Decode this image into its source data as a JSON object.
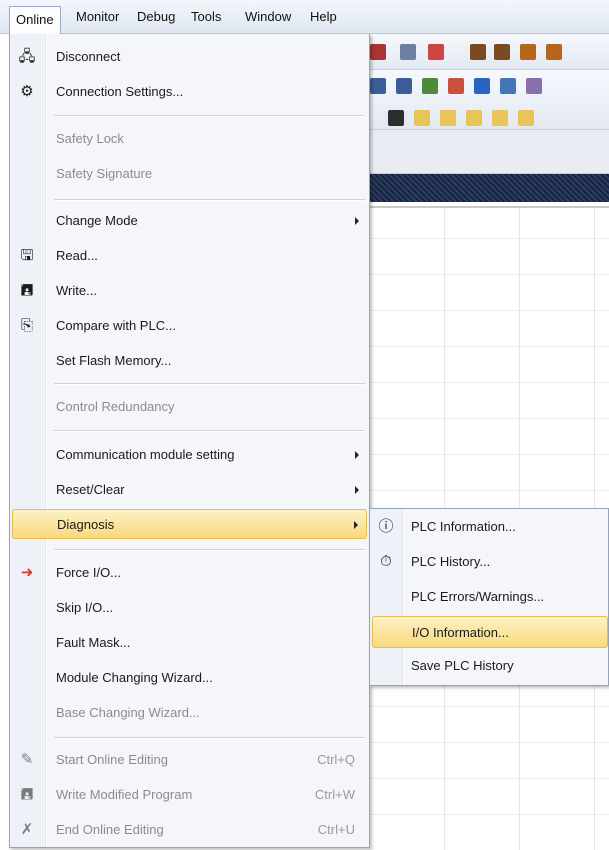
{
  "menubar": {
    "items": [
      {
        "label": "Online"
      },
      {
        "label": "Monitor"
      },
      {
        "label": "Debug"
      },
      {
        "label": "Tools"
      },
      {
        "label": "Window"
      },
      {
        "label": "Help"
      }
    ]
  },
  "online_menu": {
    "items": [
      {
        "label": "Disconnect",
        "icon": "disconnect-icon"
      },
      {
        "label": "Connection Settings...",
        "icon": "connection-settings-icon"
      },
      {
        "label": "Safety Lock"
      },
      {
        "label": "Safety Signature"
      },
      {
        "label": "Change Mode"
      },
      {
        "label": "Read...",
        "icon": "read-icon"
      },
      {
        "label": "Write...",
        "icon": "write-icon"
      },
      {
        "label": "Compare with PLC...",
        "icon": "compare-icon"
      },
      {
        "label": "Set Flash Memory..."
      },
      {
        "label": "Control Redundancy"
      },
      {
        "label": "Communication module setting"
      },
      {
        "label": "Reset/Clear"
      },
      {
        "label": "Diagnosis"
      },
      {
        "label": "Force I/O...",
        "icon": "force-io-icon"
      },
      {
        "label": "Skip I/O..."
      },
      {
        "label": "Fault Mask..."
      },
      {
        "label": "Module Changing Wizard..."
      },
      {
        "label": "Base Changing Wizard..."
      },
      {
        "label": "Start Online Editing",
        "shortcut": "Ctrl+Q",
        "icon": "online-edit-icon"
      },
      {
        "label": "Write Modified Program",
        "shortcut": "Ctrl+W",
        "icon": "write-modified-icon"
      },
      {
        "label": "End Online Editing",
        "shortcut": "Ctrl+U",
        "icon": "end-edit-icon"
      }
    ]
  },
  "diagnosis_submenu": {
    "items": [
      {
        "label": "PLC Information...",
        "icon": "plc-information-icon"
      },
      {
        "label": "PLC History...",
        "icon": "plc-history-icon"
      },
      {
        "label": "PLC Errors/Warnings..."
      },
      {
        "label": "I/O Information..."
      },
      {
        "label": "Save PLC History"
      }
    ]
  },
  "colors": {
    "highlight": "#f9d97c",
    "menu_background": "#f5f6f9",
    "menubar": "#dfe7f2"
  }
}
